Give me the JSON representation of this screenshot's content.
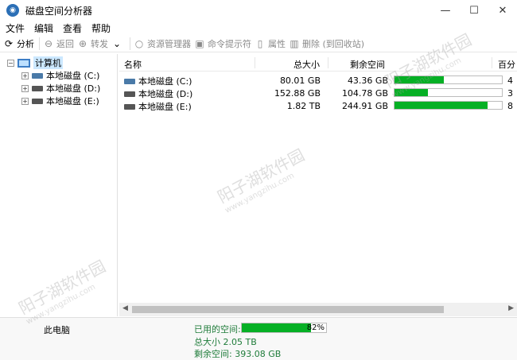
{
  "window": {
    "title": "磁盘空间分析器"
  },
  "menu": {
    "items": [
      "文件",
      "编辑",
      "查看",
      "帮助"
    ]
  },
  "toolbar": {
    "analyze": "分析",
    "back": "返回",
    "forward": "转发",
    "explorer": "资源管理器",
    "cmd": "命令提示符",
    "properties": "属性",
    "delete": "删除 (到回收站)"
  },
  "tree": {
    "root": "计算机",
    "drives": [
      "本地磁盘 (C:)",
      "本地磁盘 (D:)",
      "本地磁盘 (E:)"
    ]
  },
  "list": {
    "headers": {
      "name": "名称",
      "total": "总大小",
      "free": "剩余空间",
      "pct": "百分"
    },
    "rows": [
      {
        "name": "本地磁盘 (C:)",
        "total": "80.01 GB",
        "free": "43.36 GB",
        "used": 0.46,
        "pct": "4"
      },
      {
        "name": "本地磁盘 (D:)",
        "total": "152.88 GB",
        "free": "104.78 GB",
        "used": 0.31,
        "pct": "3"
      },
      {
        "name": "本地磁盘 (E:)",
        "total": "1.82 TB",
        "free": "244.91 GB",
        "used": 0.87,
        "pct": "8"
      }
    ]
  },
  "status": {
    "location": "此电脑",
    "used_label": "已用的空间:",
    "used_pct": "82%",
    "used_fraction": 0.82,
    "total": "总大小 2.05 TB",
    "free": "剩余空间: 393.08 GB"
  },
  "watermark": {
    "text": "阳子湖软件园",
    "url": "www.yangzihu.com"
  }
}
